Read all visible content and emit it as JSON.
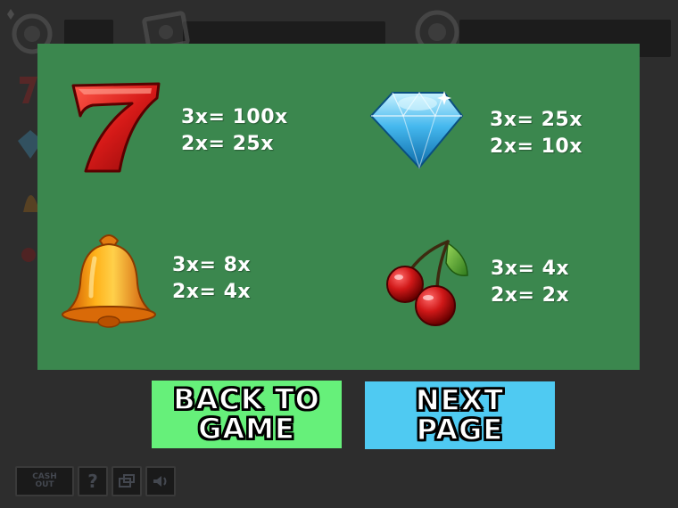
{
  "paytable": {
    "rows": [
      {
        "symbol": "seven",
        "icon": "lucky-seven-icon",
        "line1": "3x= 100x",
        "line2": "2x= 25x"
      },
      {
        "symbol": "diamond",
        "icon": "diamond-icon",
        "line1": "3x= 25x",
        "line2": "2x= 10x"
      },
      {
        "symbol": "bell",
        "icon": "bell-icon",
        "line1": "3x= 8x",
        "line2": "2x= 4x"
      },
      {
        "symbol": "cherry",
        "icon": "cherry-icon",
        "line1": "3x= 4x",
        "line2": "2x= 2x"
      }
    ]
  },
  "buttons": {
    "back_line1": "BACK TO",
    "back_line2": "GAME",
    "next_line1": "NEXT",
    "next_line2": "PAGE"
  },
  "toolbar": {
    "cashout_line1": "CASH",
    "cashout_line2": "OUT",
    "help_label": "?"
  },
  "colors": {
    "panel": "#3b874e",
    "back_button": "#66f07a",
    "next_button": "#4fcaf2",
    "background": "#2d2d2d"
  }
}
